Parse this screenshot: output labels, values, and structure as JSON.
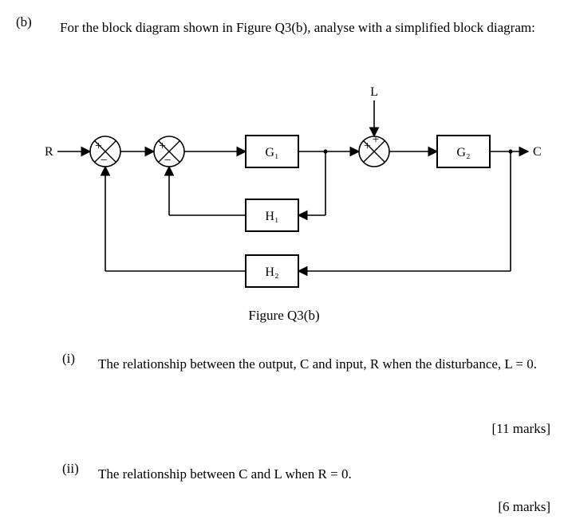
{
  "question": {
    "part_label": "(b)",
    "prompt": "For the block diagram shown in Figure Q3(b), analyse with a simplified block diagram:",
    "figure_caption": "Figure Q3(b)"
  },
  "diagram": {
    "inputs": {
      "R": "R",
      "L": "L"
    },
    "output": "C",
    "blocks": {
      "G1": "G₁",
      "G2": "G₂",
      "H1": "H₁",
      "H2": "H₂"
    },
    "summing_junctions": [
      {
        "id": "S1",
        "signs": [
          "+",
          "−"
        ]
      },
      {
        "id": "S2",
        "signs": [
          "+",
          "−"
        ]
      },
      {
        "id": "S3",
        "signs": [
          "+",
          "+"
        ]
      }
    ]
  },
  "subparts": [
    {
      "roman": "(i)",
      "text": "The relationship between the output, C and input, R when the disturbance, L = 0.",
      "marks": "[11 marks]"
    },
    {
      "roman": "(ii)",
      "text": "The relationship between C and L when R = 0.",
      "marks": "[6 marks]"
    }
  ]
}
